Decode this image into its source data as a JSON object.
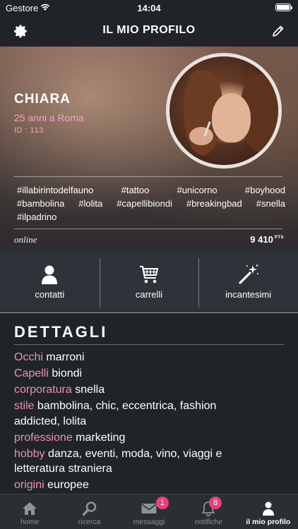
{
  "status_bar": {
    "carrier": "Gestore",
    "time": "14:04"
  },
  "navbar": {
    "title": "IL MIO PROFILO"
  },
  "profile": {
    "name": "CHIARA",
    "age_city": "25 anni a Roma",
    "id_text": "ID : 113",
    "hashtags": [
      [
        "#illabirintodelfauno",
        "#tattoo",
        "#unicorno",
        "#boyhood"
      ],
      [
        "#bambolina",
        "#lolita",
        "#capellibiondi",
        "#breakingbad",
        "#snella"
      ],
      [
        "#ilpadrino"
      ]
    ],
    "status": "online",
    "points": "9 410",
    "points_unit": "PTS"
  },
  "actions": [
    {
      "label": "contatti",
      "icon": "user-icon"
    },
    {
      "label": "carrelli",
      "icon": "cart-icon"
    },
    {
      "label": "incantesimi",
      "icon": "magic-wand-icon"
    }
  ],
  "details": {
    "heading": "DETTAGLI",
    "items": [
      {
        "key": "Occhi",
        "value": "marroni"
      },
      {
        "key": "Capelli",
        "value": "biondi"
      },
      {
        "key": "corporatura",
        "value": "snella"
      },
      {
        "key": "stile",
        "value": "bambolina, chic, eccentrica, fashion addicted, lolita"
      },
      {
        "key": "professione",
        "value": "marketing"
      },
      {
        "key": "hobby",
        "value": "danza, eventi, moda, vino, viaggi e letteratura straniera"
      },
      {
        "key": "origini",
        "value": "europee"
      }
    ]
  },
  "tabbar": {
    "tabs": [
      {
        "label": "home",
        "icon": "home-icon"
      },
      {
        "label": "ricerca",
        "icon": "search-icon"
      },
      {
        "label": "messaggi",
        "icon": "mail-icon",
        "badge": "1"
      },
      {
        "label": "notifiche",
        "icon": "bell-icon",
        "badge": "8"
      },
      {
        "label": "il mio profilo",
        "icon": "profile-icon"
      }
    ]
  },
  "colors": {
    "accent": "#ec8fb9",
    "badge": "#e8407a",
    "background": "#202428"
  }
}
